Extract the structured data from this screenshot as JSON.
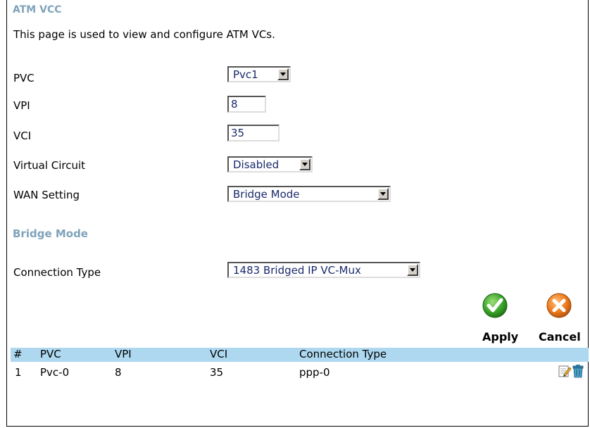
{
  "page": {
    "title": "ATM VCC",
    "description": "This page is used to view and configure ATM VCs."
  },
  "form": {
    "pvc": {
      "label": "PVC",
      "value": "Pvc1"
    },
    "vpi": {
      "label": "VPI",
      "value": "8"
    },
    "vci": {
      "label": "VCI",
      "value": "35"
    },
    "virtual_circuit": {
      "label": "Virtual Circuit",
      "value": "Disabled"
    },
    "wan_setting": {
      "label": "WAN Setting",
      "value": "Bridge Mode"
    },
    "section_title": "Bridge Mode",
    "connection_type": {
      "label": "Connection Type",
      "value": "1483 Bridged IP VC-Mux"
    }
  },
  "buttons": {
    "apply_label": "Apply",
    "cancel_label": "Cancel"
  },
  "table": {
    "headers": [
      "#",
      "PVC",
      "VPI",
      "VCI",
      "Connection Type"
    ],
    "rows": [
      [
        "1",
        "Pvc-0",
        "8",
        "35",
        "ppp-0"
      ]
    ]
  },
  "icons": {
    "apply": "check-circle-icon",
    "cancel": "x-circle-icon",
    "edit": "edit-icon",
    "delete": "trash-icon"
  },
  "colors": {
    "heading": "#7fa3ba",
    "table_header_bg": "#add8f0",
    "apply_green": "#2e9e1e",
    "cancel_orange": "#e8761a",
    "field_text": "#1a2a6c"
  }
}
